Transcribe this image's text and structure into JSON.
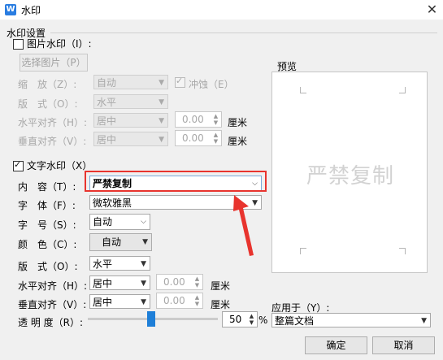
{
  "window": {
    "title": "水印",
    "app_icon": "W"
  },
  "watermark_settings": {
    "group_label": "水印设置"
  },
  "picture": {
    "checkbox_label": "图片水印（I）:",
    "select_button": "选择图片（P）",
    "scale_label": "缩　放（Z）:",
    "scale_value": "自动",
    "washout_label": "冲蚀（E）",
    "layout_label": "版　式（O）:",
    "layout_value": "水平",
    "halign_label": "水平对齐（H）:",
    "halign_value": "居中",
    "halign_offset": "0.00",
    "valign_label": "垂直对齐（V）:",
    "valign_value": "居中",
    "valign_offset": "0.00",
    "unit": "厘米"
  },
  "text": {
    "checkbox_label": "文字水印（X）",
    "content_label": "内　容（T）:",
    "content_value": "严禁复制",
    "font_label": "字　体（F）:",
    "font_value": "微软雅黑",
    "size_label": "字　号（S）:",
    "size_value": "自动",
    "color_label": "颜　色（C）:",
    "color_value": "自动",
    "layout_label": "版　式（O）:",
    "layout_value": "水平",
    "halign_label": "水平对齐（H）:",
    "halign_value": "居中",
    "halign_offset": "0.00",
    "valign_label": "垂直对齐（V）:",
    "valign_value": "居中",
    "valign_offset": "0.00",
    "unit": "厘米",
    "transparency_label": "透 明 度（R）:",
    "transparency_value": "50",
    "transparency_unit": "%",
    "transparency_level": 0.5
  },
  "preview": {
    "label": "预览",
    "watermark_text": "严禁复制"
  },
  "apply": {
    "label": "应用于（Y）:",
    "value": "整篇文档"
  },
  "buttons": {
    "ok": "确定",
    "cancel": "取消"
  },
  "colors": {
    "highlight": "#e8342e",
    "accent": "#1e7fd8"
  }
}
